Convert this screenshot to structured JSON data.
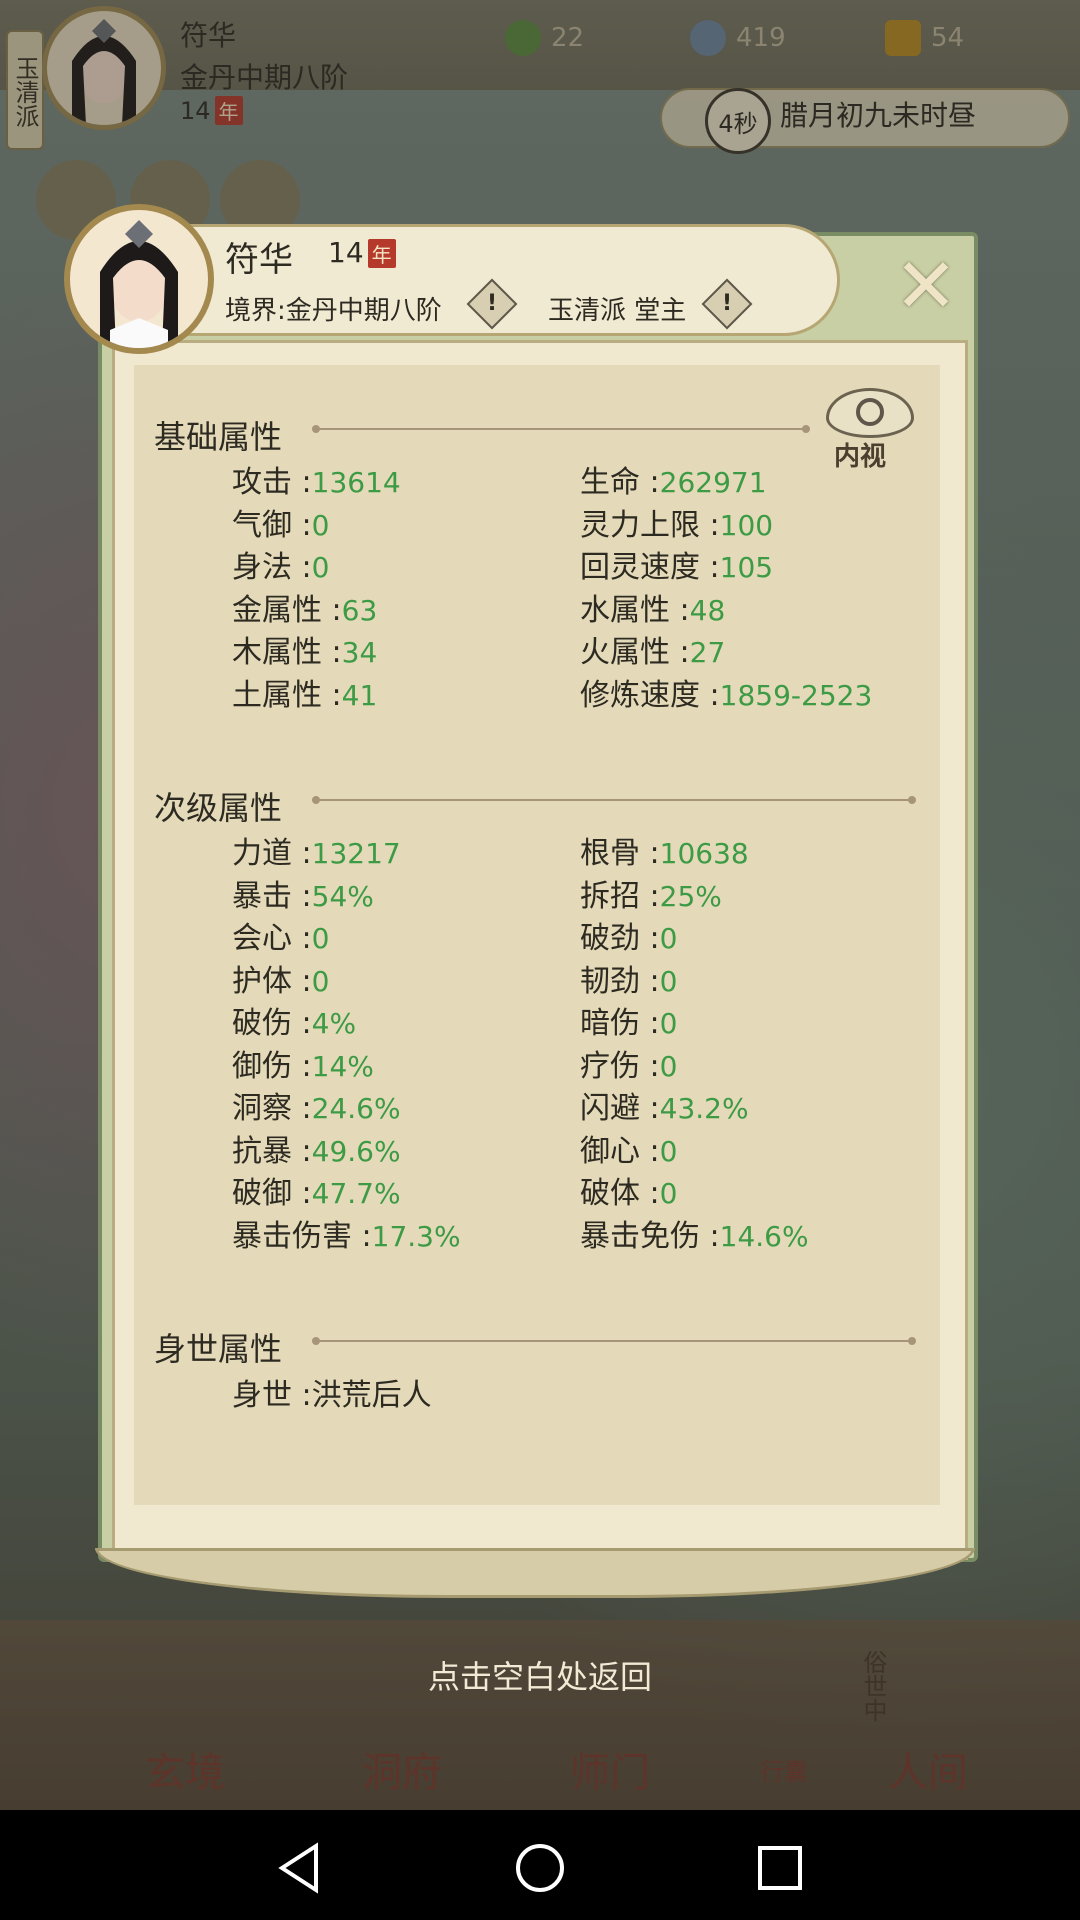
{
  "top": {
    "sect_tag": "玉清派",
    "name": "符华",
    "realm": "金丹中期八阶",
    "age": "14",
    "year_badge": "年",
    "res1": "22",
    "res2": "419",
    "res3": "54",
    "time_seconds": "4秒",
    "time_label": "腊月初九未时昼"
  },
  "header": {
    "name": "符华",
    "age": "14",
    "year_badge": "年",
    "realm": "境界:金丹中期八阶",
    "sect": "玉清派 堂主",
    "info_icon": "!",
    "eye_label": "内视"
  },
  "basic": {
    "title": "基础属性",
    "left": [
      {
        "label": "攻击 :",
        "value": "13614"
      },
      {
        "label": "气御 :",
        "value": "0"
      },
      {
        "label": "身法 :",
        "value": "0"
      },
      {
        "label": "金属性 :",
        "value": "63"
      },
      {
        "label": "木属性 :",
        "value": "34"
      },
      {
        "label": "土属性 :",
        "value": "41"
      }
    ],
    "right": [
      {
        "label": "生命 :",
        "value": "262971"
      },
      {
        "label": "灵力上限 :",
        "value": "100"
      },
      {
        "label": "回灵速度 :",
        "value": "105"
      },
      {
        "label": "水属性 :",
        "value": "48"
      },
      {
        "label": "火属性 :",
        "value": "27"
      },
      {
        "label": "修炼速度 :",
        "value": "1859-2523"
      }
    ]
  },
  "secondary": {
    "title": "次级属性",
    "left": [
      {
        "label": "力道 :",
        "value": "13217"
      },
      {
        "label": "暴击 :",
        "value": "54%"
      },
      {
        "label": "会心 :",
        "value": "0"
      },
      {
        "label": "护体 :",
        "value": "0"
      },
      {
        "label": "破伤 :",
        "value": "4%"
      },
      {
        "label": "御伤 :",
        "value": "14%"
      },
      {
        "label": "洞察 :",
        "value": "24.6%"
      },
      {
        "label": "抗暴 :",
        "value": "49.6%"
      },
      {
        "label": "破御 :",
        "value": "47.7%"
      },
      {
        "label": "暴击伤害 :",
        "value": "17.3%"
      }
    ],
    "right": [
      {
        "label": "根骨 :",
        "value": "10638"
      },
      {
        "label": "拆招 :",
        "value": "25%"
      },
      {
        "label": "破劲 :",
        "value": "0"
      },
      {
        "label": "韧劲 :",
        "value": "0"
      },
      {
        "label": "暗伤 :",
        "value": "0"
      },
      {
        "label": "疗伤 :",
        "value": "0"
      },
      {
        "label": "闪避 :",
        "value": "43.2%"
      },
      {
        "label": "御心 :",
        "value": "0"
      },
      {
        "label": "破体 :",
        "value": "0"
      },
      {
        "label": "暴击免伤 :",
        "value": "14.6%"
      }
    ]
  },
  "background": {
    "title": "身世属性",
    "label": "身世 :",
    "value": "洪荒后人"
  },
  "return_hint": "点击空白处返回",
  "bottom_nav": {
    "xuanjing": "玄境",
    "dongfu": "洞府",
    "shimen": "师门",
    "xingnang": "行囊",
    "renjian": "人间",
    "sushizhong": "俗世中"
  },
  "colors": {
    "value_green": "#3d9a45",
    "accent_red": "#b63a2c"
  }
}
